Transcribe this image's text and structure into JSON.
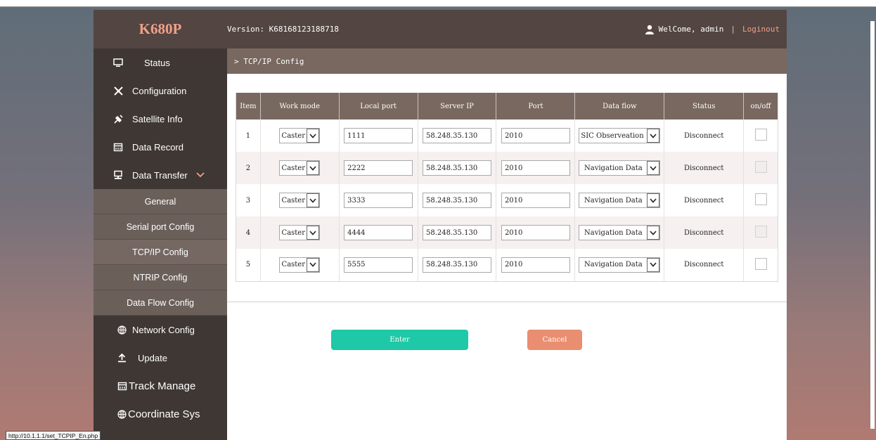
{
  "header": {
    "logo": "K680P",
    "version": "Version: K68168123188718",
    "welcome": "WelCome, admin",
    "separator": "|",
    "logout": "Loginout"
  },
  "sidebar": {
    "status": "Status",
    "configuration": "Configuration",
    "satellite": "Satellite Info",
    "data_record": "Data Record",
    "data_transfer": "Data Transfer",
    "sub": {
      "general": "General",
      "serial": "Serial port Config",
      "tcpip": "TCP/IP Config",
      "ntrip": "NTRIP Config",
      "dataflow": "Data Flow Config"
    },
    "network": "Network Config",
    "update": "Update",
    "track": "Track Manage",
    "coord": "Coordinate Sys"
  },
  "breadcrumb": "> TCP/IP Config",
  "table": {
    "headers": [
      "Item",
      "Work mode",
      "Local port",
      "Server IP",
      "Port",
      "Data flow",
      "Status",
      "on/off"
    ],
    "rows": [
      {
        "item": "1",
        "mode": "Caster",
        "local_port": "1111",
        "server_ip": "58.248.35.130",
        "port": "2010",
        "flow": "SIC Observeation D",
        "status": "Disconnect"
      },
      {
        "item": "2",
        "mode": "Caster",
        "local_port": "2222",
        "server_ip": "58.248.35.130",
        "port": "2010",
        "flow": "Navigation Data",
        "status": "Disconnect"
      },
      {
        "item": "3",
        "mode": "Caster",
        "local_port": "3333",
        "server_ip": "58.248.35.130",
        "port": "2010",
        "flow": "Navigation Data",
        "status": "Disconnect"
      },
      {
        "item": "4",
        "mode": "Caster",
        "local_port": "4444",
        "server_ip": "58.248.35.130",
        "port": "2010",
        "flow": "Navigation Data",
        "status": "Disconnect"
      },
      {
        "item": "5",
        "mode": "Caster",
        "local_port": "5555",
        "server_ip": "58.248.35.130",
        "port": "2010",
        "flow": "Navigation Data",
        "status": "Disconnect"
      }
    ]
  },
  "buttons": {
    "enter": "Enter",
    "cancel": "Cancel"
  },
  "statusbar": "http://10.1.1.1/set_TCPIP_En.php",
  "colors": {
    "header": "#534541",
    "sidebar": "#3e3733",
    "accent": "#1fc8a6",
    "cancel": "#e98e70",
    "logo": "#f0a08a"
  }
}
